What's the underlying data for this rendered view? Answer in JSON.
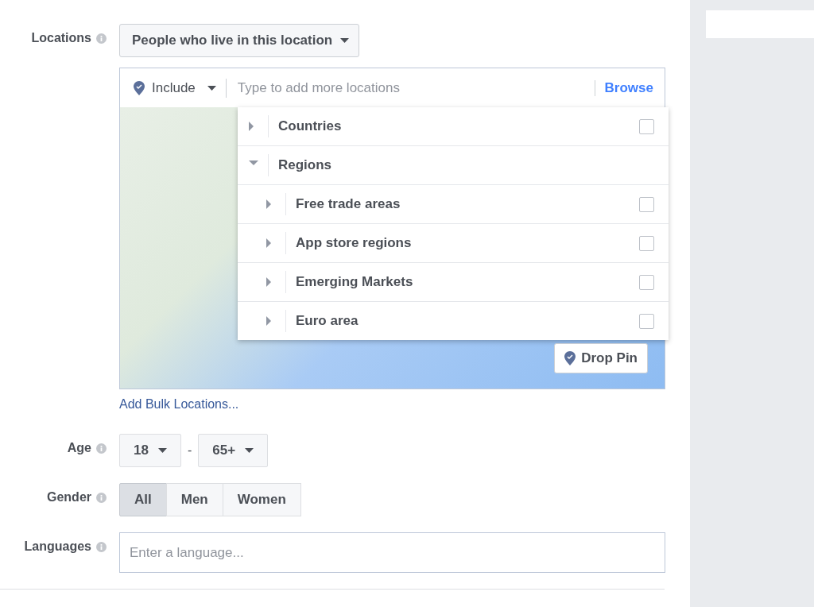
{
  "locations": {
    "label": "Locations",
    "audience_select": "People who live in this location",
    "include_select": "Include",
    "search": {
      "placeholder": "Type to add more locations"
    },
    "browse_link": "Browse",
    "browse_tree": [
      {
        "label": "Countries",
        "expanded": false,
        "checked": false
      },
      {
        "label": "Regions",
        "expanded": true,
        "children": [
          {
            "label": "Free trade areas",
            "expanded": false,
            "checked": false
          },
          {
            "label": "App store regions",
            "expanded": false,
            "checked": false
          },
          {
            "label": "Emerging Markets",
            "expanded": false,
            "checked": false
          },
          {
            "label": "Euro area",
            "expanded": false,
            "checked": false
          }
        ]
      }
    ],
    "drop_pin": "Drop Pin",
    "bulk_link": "Add Bulk Locations..."
  },
  "age": {
    "label": "Age",
    "min": "18",
    "separator": "-",
    "max": "65+"
  },
  "gender": {
    "label": "Gender",
    "options": [
      {
        "label": "All",
        "selected": true
      },
      {
        "label": "Men",
        "selected": false
      },
      {
        "label": "Women",
        "selected": false
      }
    ]
  },
  "languages": {
    "label": "Languages",
    "placeholder": "Enter a language..."
  }
}
